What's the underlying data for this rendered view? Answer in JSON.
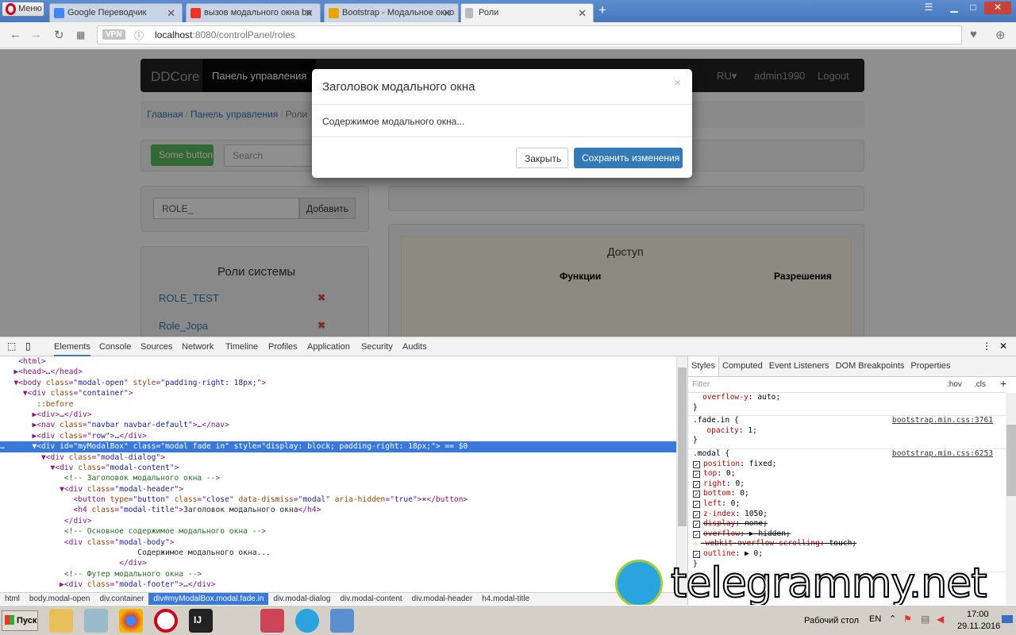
{
  "browser": {
    "menu_label": "Меню",
    "tabs": [
      {
        "title": "Google Переводчик",
        "color": "#4285f4"
      },
      {
        "title": "вызов модального окна bo",
        "color": "#e32"
      },
      {
        "title": "Bootstrap - Модальное окно",
        "color": "#e8a400"
      },
      {
        "title": "Роли",
        "color": "#888"
      }
    ],
    "new_tab": "+",
    "vpn": "VPN",
    "url_host": "localhost",
    "url_rest": ":8080/controlPanel/roles"
  },
  "page": {
    "brand": "DDCore",
    "nav_active": "Панель управления",
    "nav_right": [
      "RU▾",
      "admin1990",
      "Logout"
    ],
    "breadcrumb": [
      "Главная",
      "Панель управления",
      "Роли"
    ],
    "some_button": "Some button",
    "search_placeholder": "Search",
    "role_input": "ROLE_",
    "add_button": "Добавить",
    "roles_title": "Роли системы",
    "roles": [
      "ROLE_TEST",
      "Role_Jopa"
    ],
    "access_title": "Доступ",
    "col_functions": "Функции",
    "col_permissions": "Разрешения"
  },
  "modal": {
    "title": "Заголовок модального окна",
    "close_glyph": "×",
    "body": "Содержимое модального окна...",
    "close_button": "Закрыть",
    "save_button": "Сохранить изменения"
  },
  "devtools": {
    "tabs": [
      "Elements",
      "Console",
      "Sources",
      "Network",
      "Timeline",
      "Profiles",
      "Application",
      "Security",
      "Audits"
    ],
    "code": [
      {
        "i": 0,
        "a": "",
        "t": [
          [
            "tag",
            "<html>"
          ]
        ]
      },
      {
        "i": 0,
        "a": "▶",
        "t": [
          [
            "tag",
            "<head>"
          ],
          [
            "txt",
            "…"
          ],
          [
            "tag",
            "</head>"
          ]
        ]
      },
      {
        "i": 0,
        "a": "▼",
        "t": [
          [
            "tag",
            "<body "
          ],
          [
            "attr",
            "class"
          ],
          [
            "tag",
            "=\""
          ],
          [
            "val",
            "modal-open"
          ],
          [
            "tag",
            "\" "
          ],
          [
            "attr",
            "style"
          ],
          [
            "tag",
            "=\""
          ],
          [
            "val",
            "padding-right: 18px;"
          ],
          [
            "tag",
            "\">"
          ]
        ]
      },
      {
        "i": 1,
        "a": "▼",
        "t": [
          [
            "tag",
            "<div "
          ],
          [
            "attr",
            "class"
          ],
          [
            "tag",
            "=\""
          ],
          [
            "val",
            "container"
          ],
          [
            "tag",
            "\">"
          ]
        ]
      },
      {
        "i": 2,
        "a": "",
        "t": [
          [
            "attr",
            "::before"
          ]
        ]
      },
      {
        "i": 2,
        "a": "▶",
        "t": [
          [
            "tag",
            "<div>"
          ],
          [
            "txt",
            "…"
          ],
          [
            "tag",
            "</div>"
          ]
        ]
      },
      {
        "i": 2,
        "a": "▶",
        "t": [
          [
            "tag",
            "<nav "
          ],
          [
            "attr",
            "class"
          ],
          [
            "tag",
            "=\""
          ],
          [
            "val",
            "navbar navbar-default"
          ],
          [
            "tag",
            "\">"
          ],
          [
            "txt",
            "…"
          ],
          [
            "tag",
            "</nav>"
          ]
        ]
      },
      {
        "i": 2,
        "a": "▶",
        "t": [
          [
            "tag",
            "<div "
          ],
          [
            "attr",
            "class"
          ],
          [
            "tag",
            "=\""
          ],
          [
            "val",
            "row"
          ],
          [
            "tag",
            "\">"
          ],
          [
            "txt",
            "…"
          ],
          [
            "tag",
            "</div>"
          ]
        ]
      },
      {
        "i": 2,
        "a": "▼",
        "hl": true,
        "t": [
          [
            "tag",
            "<div "
          ],
          [
            "attr",
            "id"
          ],
          [
            "tag",
            "=\""
          ],
          [
            "val",
            "myModalBox"
          ],
          [
            "tag",
            "\" "
          ],
          [
            "attr",
            "class"
          ],
          [
            "tag",
            "=\""
          ],
          [
            "val",
            "modal fade in"
          ],
          [
            "tag",
            "\" "
          ],
          [
            "attr",
            "style"
          ],
          [
            "tag",
            "=\""
          ],
          [
            "val",
            "display: block; padding-right: 18px;"
          ],
          [
            "tag",
            "\">"
          ],
          [
            "txt",
            " == $0"
          ]
        ]
      },
      {
        "i": 3,
        "a": "▼",
        "t": [
          [
            "tag",
            "<div "
          ],
          [
            "attr",
            "class"
          ],
          [
            "tag",
            "=\""
          ],
          [
            "val",
            "modal-dialog"
          ],
          [
            "tag",
            "\">"
          ]
        ]
      },
      {
        "i": 4,
        "a": "▼",
        "t": [
          [
            "tag",
            "<div "
          ],
          [
            "attr",
            "class"
          ],
          [
            "tag",
            "=\""
          ],
          [
            "val",
            "modal-content"
          ],
          [
            "tag",
            "\">"
          ]
        ]
      },
      {
        "i": 5,
        "a": "",
        "t": [
          [
            "com",
            "<!-- Заголовок модального окна -->"
          ]
        ]
      },
      {
        "i": 5,
        "a": "▼",
        "t": [
          [
            "tag",
            "<div "
          ],
          [
            "attr",
            "class"
          ],
          [
            "tag",
            "=\""
          ],
          [
            "val",
            "modal-header"
          ],
          [
            "tag",
            "\">"
          ]
        ]
      },
      {
        "i": 6,
        "a": "",
        "t": [
          [
            "tag",
            "<button "
          ],
          [
            "attr",
            "type"
          ],
          [
            "tag",
            "=\""
          ],
          [
            "val",
            "button"
          ],
          [
            "tag",
            "\" "
          ],
          [
            "attr",
            "class"
          ],
          [
            "tag",
            "=\""
          ],
          [
            "val",
            "close"
          ],
          [
            "tag",
            "\" "
          ],
          [
            "attr",
            "data-dismiss"
          ],
          [
            "tag",
            "=\""
          ],
          [
            "val",
            "modal"
          ],
          [
            "tag",
            "\" "
          ],
          [
            "attr",
            "aria-hidden"
          ],
          [
            "tag",
            "=\""
          ],
          [
            "val",
            "true"
          ],
          [
            "tag",
            "\">"
          ],
          [
            "txt",
            "×"
          ],
          [
            "tag",
            "</button>"
          ]
        ]
      },
      {
        "i": 6,
        "a": "",
        "t": [
          [
            "tag",
            "<h4 "
          ],
          [
            "attr",
            "class"
          ],
          [
            "tag",
            "=\""
          ],
          [
            "val",
            "modal-title"
          ],
          [
            "tag",
            "\">"
          ],
          [
            "txt",
            "Заголовок модального окна"
          ],
          [
            "tag",
            "</h4>"
          ]
        ]
      },
      {
        "i": 5,
        "a": "",
        "t": [
          [
            "tag",
            "</div>"
          ]
        ]
      },
      {
        "i": 5,
        "a": "",
        "t": [
          [
            "com",
            "<!-- Основное содержимое модального окна -->"
          ]
        ]
      },
      {
        "i": 5,
        "a": "",
        "t": [
          [
            "tag",
            "<div "
          ],
          [
            "attr",
            "class"
          ],
          [
            "tag",
            "=\""
          ],
          [
            "val",
            "modal-body"
          ],
          [
            "tag",
            "\">"
          ]
        ]
      },
      {
        "i": 13,
        "a": "",
        "t": [
          [
            "txt",
            "Содержимое модального окна..."
          ]
        ]
      },
      {
        "i": 11,
        "a": "",
        "t": [
          [
            "tag",
            "</div>"
          ]
        ]
      },
      {
        "i": 5,
        "a": "",
        "t": [
          [
            "com",
            "<!-- Футер модального окна -->"
          ]
        ]
      },
      {
        "i": 5,
        "a": "▶",
        "t": [
          [
            "tag",
            "<div "
          ],
          [
            "attr",
            "class"
          ],
          [
            "tag",
            "=\""
          ],
          [
            "val",
            "modal-footer"
          ],
          [
            "tag",
            "\">"
          ],
          [
            "txt",
            "…"
          ],
          [
            "tag",
            "</div>"
          ]
        ]
      }
    ],
    "breadcrumb": [
      "html",
      "body.modal-open",
      "div.container",
      "div#myModalBox.modal.fade.in",
      "div.modal-dialog",
      "div.modal-content",
      "div.modal-header",
      "h4.modal-title"
    ],
    "styles_tabs": [
      "Styles",
      "Computed",
      "Event Listeners",
      "DOM Breakpoints",
      "Properties"
    ],
    "filter_placeholder": "Filter",
    "hov": ":hov",
    "cls": ".cls",
    "rule0": {
      "prop": "overflow-y",
      "val": "auto"
    },
    "rule1": {
      "selector": ".fade.in {",
      "source": "bootstrap.min.css:3761",
      "props": [
        {
          "p": "opacity",
          "v": "1"
        }
      ]
    },
    "rule2": {
      "selector": ".modal {",
      "source": "bootstrap.min.css:6253",
      "props": [
        {
          "p": "position",
          "v": "fixed"
        },
        {
          "p": "top",
          "v": "0"
        },
        {
          "p": "right",
          "v": "0"
        },
        {
          "p": "bottom",
          "v": "0"
        },
        {
          "p": "left",
          "v": "0"
        },
        {
          "p": "z-index",
          "v": "1050"
        },
        {
          "p": "display",
          "v": "none",
          "s": true
        },
        {
          "p": "overflow",
          "v": "▶ hidden",
          "s": true
        },
        {
          "p": "-webkit-overflow-scrolling",
          "v": "touch",
          "s": true,
          "warn": true
        },
        {
          "p": "outline",
          "v": "▶ 0"
        }
      ]
    }
  },
  "watermark": "telegrammy.net",
  "taskbar": {
    "start": "Пуск",
    "desktop": "Рабочий стол",
    "lang": "EN",
    "time": "17:00",
    "date": "29.11.2016"
  }
}
